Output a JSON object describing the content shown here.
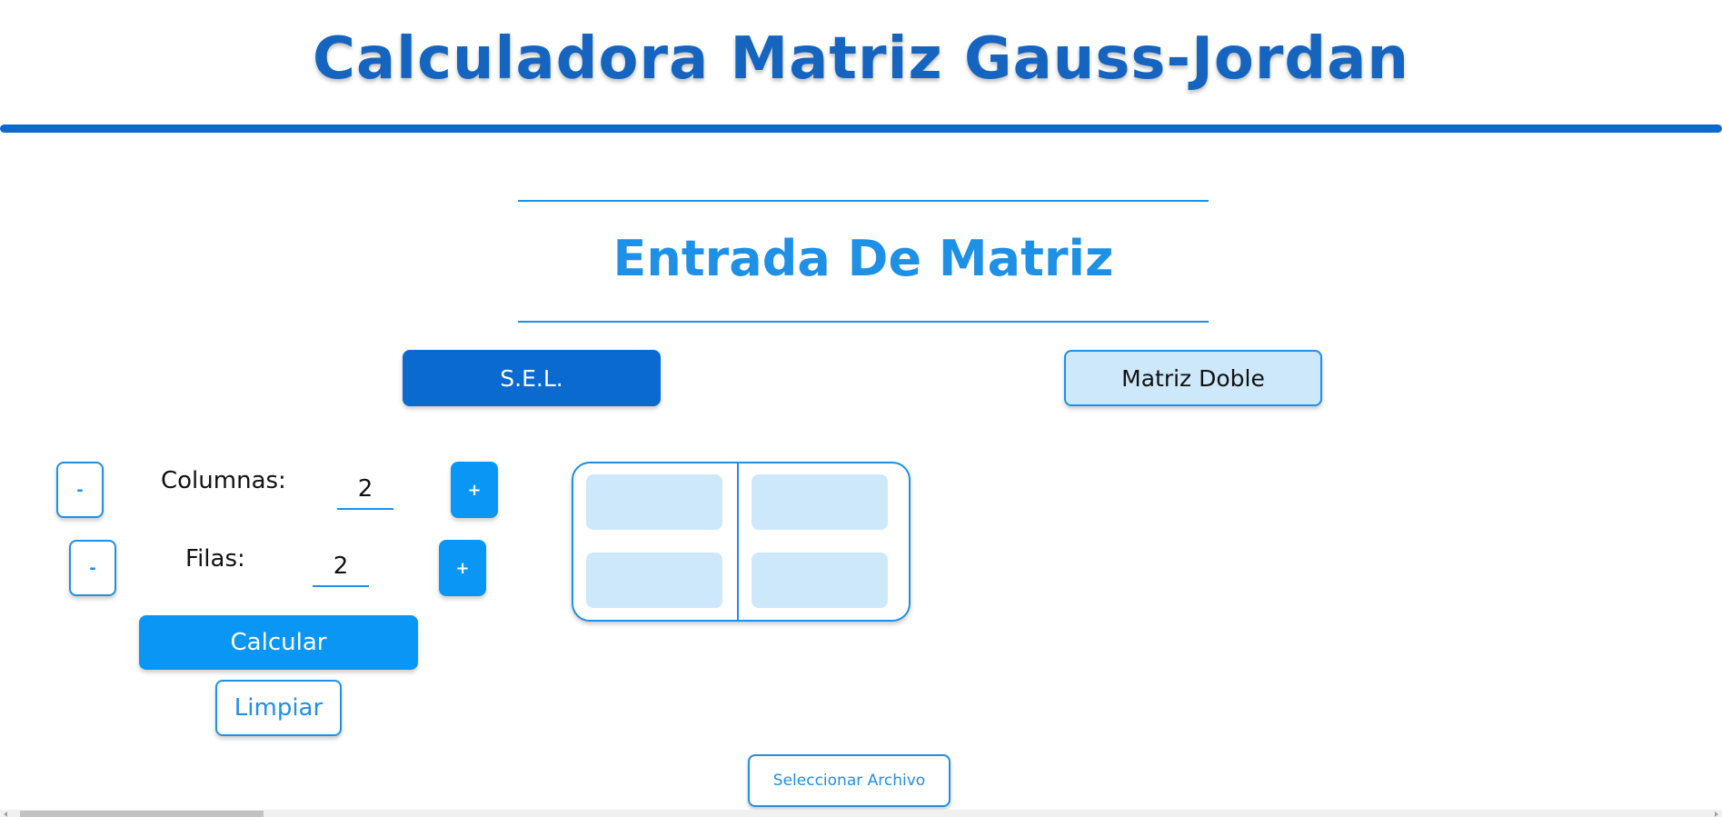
{
  "header": {
    "title": "Calculadora Matriz Gauss-Jordan"
  },
  "section": {
    "title": "Entrada De Matriz"
  },
  "modes": {
    "sel_label": "S.E.L.",
    "double_label": "Matriz Doble",
    "active": "S.E.L."
  },
  "controls": {
    "columns_label": "Columnas:",
    "columns_value": "2",
    "rows_label": "Filas:",
    "rows_value": "2",
    "minus_label": "-",
    "plus_label": "+"
  },
  "matrix": {
    "cells": [
      [
        "",
        ""
      ],
      [
        "",
        ""
      ]
    ]
  },
  "actions": {
    "calculate_label": "Calcular",
    "clear_label": "Limpiar",
    "file_label": "Seleccionar Archivo"
  },
  "colors": {
    "primary": "#0a6ad0",
    "accent": "#0a96f5",
    "cell_fill": "#cde8fb",
    "title": "#1565c0"
  }
}
